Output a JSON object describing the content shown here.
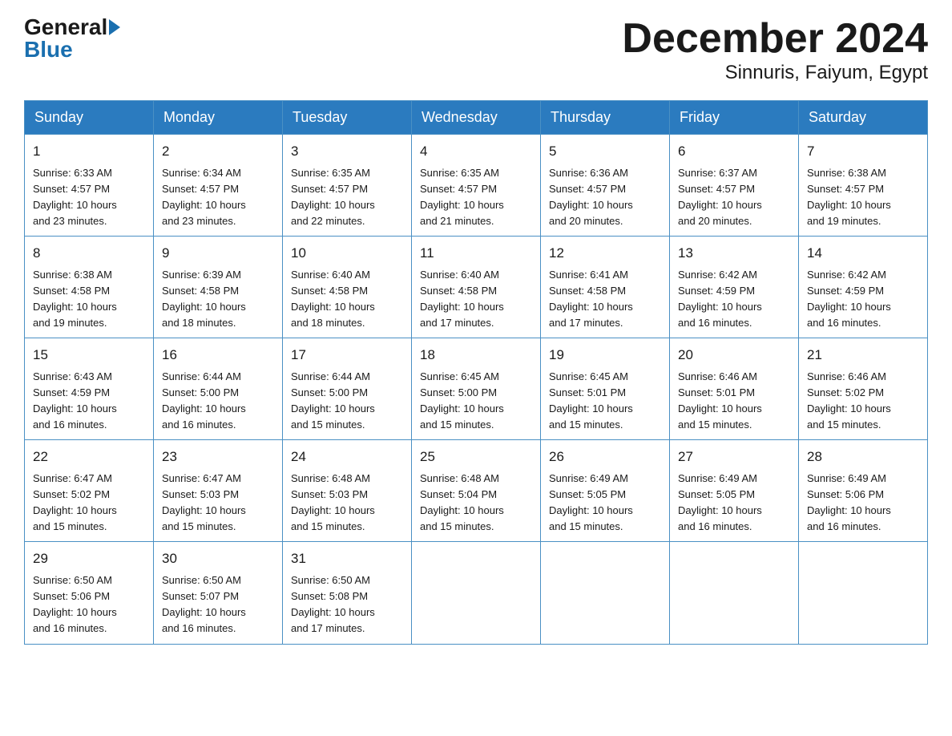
{
  "header": {
    "logo_general": "General",
    "logo_blue": "Blue",
    "title": "December 2024",
    "subtitle": "Sinnuris, Faiyum, Egypt"
  },
  "days_of_week": [
    "Sunday",
    "Monday",
    "Tuesday",
    "Wednesday",
    "Thursday",
    "Friday",
    "Saturday"
  ],
  "weeks": [
    [
      {
        "day": "1",
        "sunrise": "6:33 AM",
        "sunset": "4:57 PM",
        "daylight": "10 hours and 23 minutes."
      },
      {
        "day": "2",
        "sunrise": "6:34 AM",
        "sunset": "4:57 PM",
        "daylight": "10 hours and 23 minutes."
      },
      {
        "day": "3",
        "sunrise": "6:35 AM",
        "sunset": "4:57 PM",
        "daylight": "10 hours and 22 minutes."
      },
      {
        "day": "4",
        "sunrise": "6:35 AM",
        "sunset": "4:57 PM",
        "daylight": "10 hours and 21 minutes."
      },
      {
        "day": "5",
        "sunrise": "6:36 AM",
        "sunset": "4:57 PM",
        "daylight": "10 hours and 20 minutes."
      },
      {
        "day": "6",
        "sunrise": "6:37 AM",
        "sunset": "4:57 PM",
        "daylight": "10 hours and 20 minutes."
      },
      {
        "day": "7",
        "sunrise": "6:38 AM",
        "sunset": "4:57 PM",
        "daylight": "10 hours and 19 minutes."
      }
    ],
    [
      {
        "day": "8",
        "sunrise": "6:38 AM",
        "sunset": "4:58 PM",
        "daylight": "10 hours and 19 minutes."
      },
      {
        "day": "9",
        "sunrise": "6:39 AM",
        "sunset": "4:58 PM",
        "daylight": "10 hours and 18 minutes."
      },
      {
        "day": "10",
        "sunrise": "6:40 AM",
        "sunset": "4:58 PM",
        "daylight": "10 hours and 18 minutes."
      },
      {
        "day": "11",
        "sunrise": "6:40 AM",
        "sunset": "4:58 PM",
        "daylight": "10 hours and 17 minutes."
      },
      {
        "day": "12",
        "sunrise": "6:41 AM",
        "sunset": "4:58 PM",
        "daylight": "10 hours and 17 minutes."
      },
      {
        "day": "13",
        "sunrise": "6:42 AM",
        "sunset": "4:59 PM",
        "daylight": "10 hours and 16 minutes."
      },
      {
        "day": "14",
        "sunrise": "6:42 AM",
        "sunset": "4:59 PM",
        "daylight": "10 hours and 16 minutes."
      }
    ],
    [
      {
        "day": "15",
        "sunrise": "6:43 AM",
        "sunset": "4:59 PM",
        "daylight": "10 hours and 16 minutes."
      },
      {
        "day": "16",
        "sunrise": "6:44 AM",
        "sunset": "5:00 PM",
        "daylight": "10 hours and 16 minutes."
      },
      {
        "day": "17",
        "sunrise": "6:44 AM",
        "sunset": "5:00 PM",
        "daylight": "10 hours and 15 minutes."
      },
      {
        "day": "18",
        "sunrise": "6:45 AM",
        "sunset": "5:00 PM",
        "daylight": "10 hours and 15 minutes."
      },
      {
        "day": "19",
        "sunrise": "6:45 AM",
        "sunset": "5:01 PM",
        "daylight": "10 hours and 15 minutes."
      },
      {
        "day": "20",
        "sunrise": "6:46 AM",
        "sunset": "5:01 PM",
        "daylight": "10 hours and 15 minutes."
      },
      {
        "day": "21",
        "sunrise": "6:46 AM",
        "sunset": "5:02 PM",
        "daylight": "10 hours and 15 minutes."
      }
    ],
    [
      {
        "day": "22",
        "sunrise": "6:47 AM",
        "sunset": "5:02 PM",
        "daylight": "10 hours and 15 minutes."
      },
      {
        "day": "23",
        "sunrise": "6:47 AM",
        "sunset": "5:03 PM",
        "daylight": "10 hours and 15 minutes."
      },
      {
        "day": "24",
        "sunrise": "6:48 AM",
        "sunset": "5:03 PM",
        "daylight": "10 hours and 15 minutes."
      },
      {
        "day": "25",
        "sunrise": "6:48 AM",
        "sunset": "5:04 PM",
        "daylight": "10 hours and 15 minutes."
      },
      {
        "day": "26",
        "sunrise": "6:49 AM",
        "sunset": "5:05 PM",
        "daylight": "10 hours and 15 minutes."
      },
      {
        "day": "27",
        "sunrise": "6:49 AM",
        "sunset": "5:05 PM",
        "daylight": "10 hours and 16 minutes."
      },
      {
        "day": "28",
        "sunrise": "6:49 AM",
        "sunset": "5:06 PM",
        "daylight": "10 hours and 16 minutes."
      }
    ],
    [
      {
        "day": "29",
        "sunrise": "6:50 AM",
        "sunset": "5:06 PM",
        "daylight": "10 hours and 16 minutes."
      },
      {
        "day": "30",
        "sunrise": "6:50 AM",
        "sunset": "5:07 PM",
        "daylight": "10 hours and 16 minutes."
      },
      {
        "day": "31",
        "sunrise": "6:50 AM",
        "sunset": "5:08 PM",
        "daylight": "10 hours and 17 minutes."
      },
      null,
      null,
      null,
      null
    ]
  ],
  "labels": {
    "sunrise": "Sunrise:",
    "sunset": "Sunset:",
    "daylight": "Daylight:"
  }
}
